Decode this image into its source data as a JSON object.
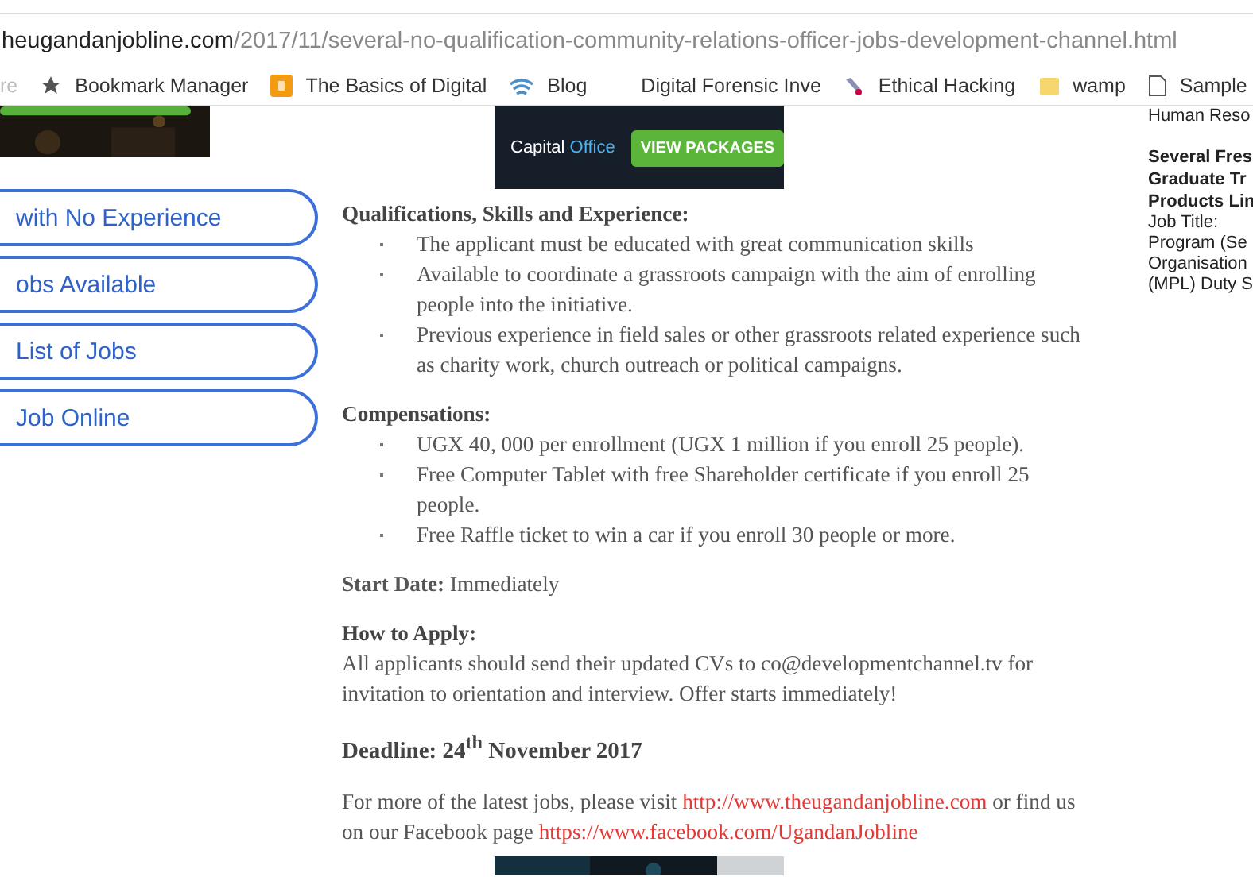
{
  "address_bar": {
    "host": "heugandanjobline.com",
    "path": "/2017/11/several-no-qualification-community-relations-officer-jobs-development-channel.html"
  },
  "bookmarks": [
    "re",
    "Bookmark Manager",
    "The Basics of Digital",
    "Blog",
    "Digital Forensic Inve",
    "Ethical Hacking",
    "wamp",
    "Sample"
  ],
  "ad_banner": {
    "brand": "Capital",
    "brand_highlight": "Office",
    "button": "VIEW PACKAGES"
  },
  "side_menu": [
    "with No Experience",
    "obs Available",
    "List of Jobs",
    "Job Online"
  ],
  "sections": [
    {
      "kind": "list",
      "heading": "Qualifications, Skills and Experience:",
      "items": [
        "The applicant must be educated with great communication skills",
        "Available to coordinate a grassroots campaign with the aim of enrolling people into the initiative.",
        "Previous experience in field sales or other grassroots related experience such as charity work, church outreach or political campaigns."
      ]
    },
    {
      "kind": "list",
      "heading": "Compensations:",
      "items": [
        "UGX 40, 000 per enrollment (UGX 1 million if you enroll 25 people).",
        "Free Computer Tablet with free Shareholder certificate if you enroll 25 people.",
        "Free Raffle ticket to win a car if you enroll 30 people or more."
      ]
    },
    {
      "kind": "line",
      "text": "**Start Date:** Immediately"
    },
    {
      "kind": "text",
      "heading": "How to Apply:",
      "text": "All applicants should send their updated CVs to co@developmentchannel.tv for invitation to orientation and interview. Offer starts immediately!"
    },
    {
      "kind": "title",
      "text": "Deadline: 24$^{th}$ November 2017"
    },
    {
      "kind": "links",
      "parts": [
        {
          "text": "For more of the latest jobs, please visit "
        },
        {
          "link": "http://www.theugandanjobline.com"
        },
        {
          "text": " or find us on our Facebook page "
        },
        {
          "link": "https://www.facebook.com/UgandanJobline"
        }
      ]
    }
  ],
  "right_sidebar": [
    {
      "text": "Human Reso",
      "bold": false
    },
    {
      "text": "Several Fres",
      "bold": true
    },
    {
      "text": "Graduate Tr",
      "bold": true
    },
    {
      "text": "Products Lin",
      "bold": true
    },
    {
      "text": "Job Title:",
      "bold": false
    },
    {
      "text": "Program (Se",
      "bold": false
    },
    {
      "text": "Organisation",
      "bold": false
    },
    {
      "text": "(MPL) Duty S",
      "bold": false
    }
  ]
}
